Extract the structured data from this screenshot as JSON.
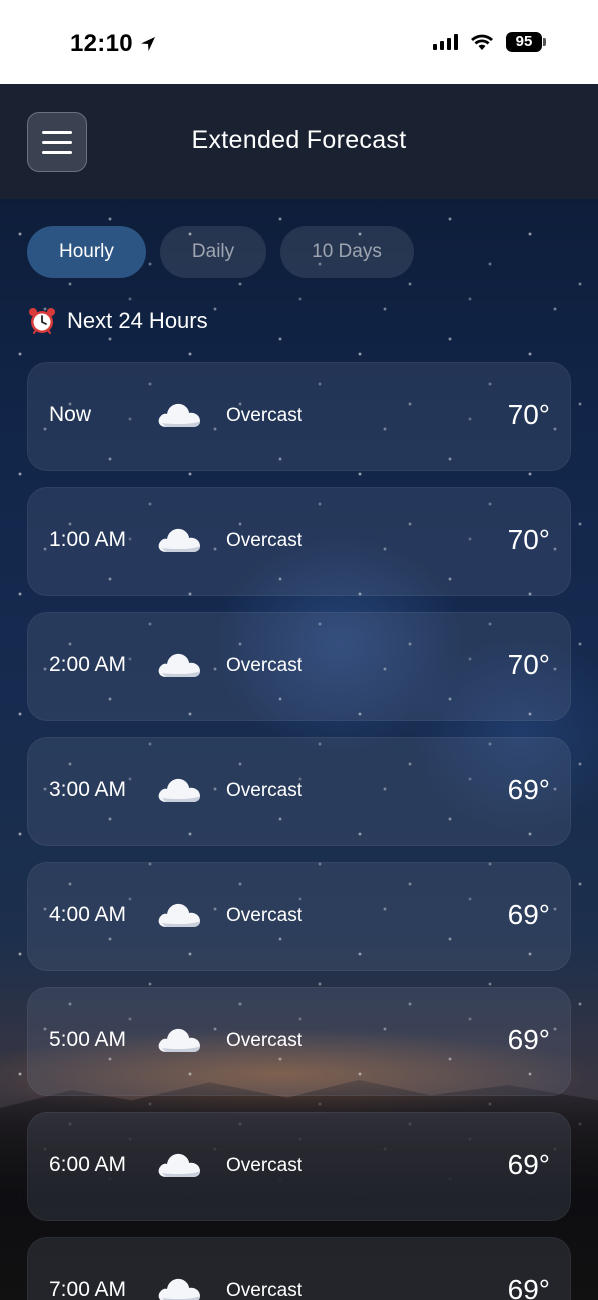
{
  "status_bar": {
    "time": "12:10",
    "battery": "95"
  },
  "header": {
    "title": "Extended Forecast"
  },
  "tabs": [
    {
      "label": "Hourly",
      "active": true
    },
    {
      "label": "Daily",
      "active": false
    },
    {
      "label": "10 Days",
      "active": false
    }
  ],
  "section": {
    "title": "Next 24 Hours",
    "icon": "alarm-clock-icon"
  },
  "forecast": [
    {
      "time": "Now",
      "icon": "cloud-icon",
      "condition": "Overcast",
      "temp": "70°"
    },
    {
      "time": "1:00 AM",
      "icon": "cloud-icon",
      "condition": "Overcast",
      "temp": "70°"
    },
    {
      "time": "2:00 AM",
      "icon": "cloud-icon",
      "condition": "Overcast",
      "temp": "70°"
    },
    {
      "time": "3:00 AM",
      "icon": "cloud-icon",
      "condition": "Overcast",
      "temp": "69°"
    },
    {
      "time": "4:00 AM",
      "icon": "cloud-icon",
      "condition": "Overcast",
      "temp": "69°"
    },
    {
      "time": "5:00 AM",
      "icon": "cloud-icon",
      "condition": "Overcast",
      "temp": "69°"
    },
    {
      "time": "6:00 AM",
      "icon": "cloud-icon",
      "condition": "Overcast",
      "temp": "69°"
    },
    {
      "time": "7:00 AM",
      "icon": "cloud-icon",
      "condition": "Overcast",
      "temp": "69°"
    }
  ],
  "colors": {
    "header_bg": "#1a2232",
    "active_tab": "#4682be",
    "text": "#ffffff"
  }
}
